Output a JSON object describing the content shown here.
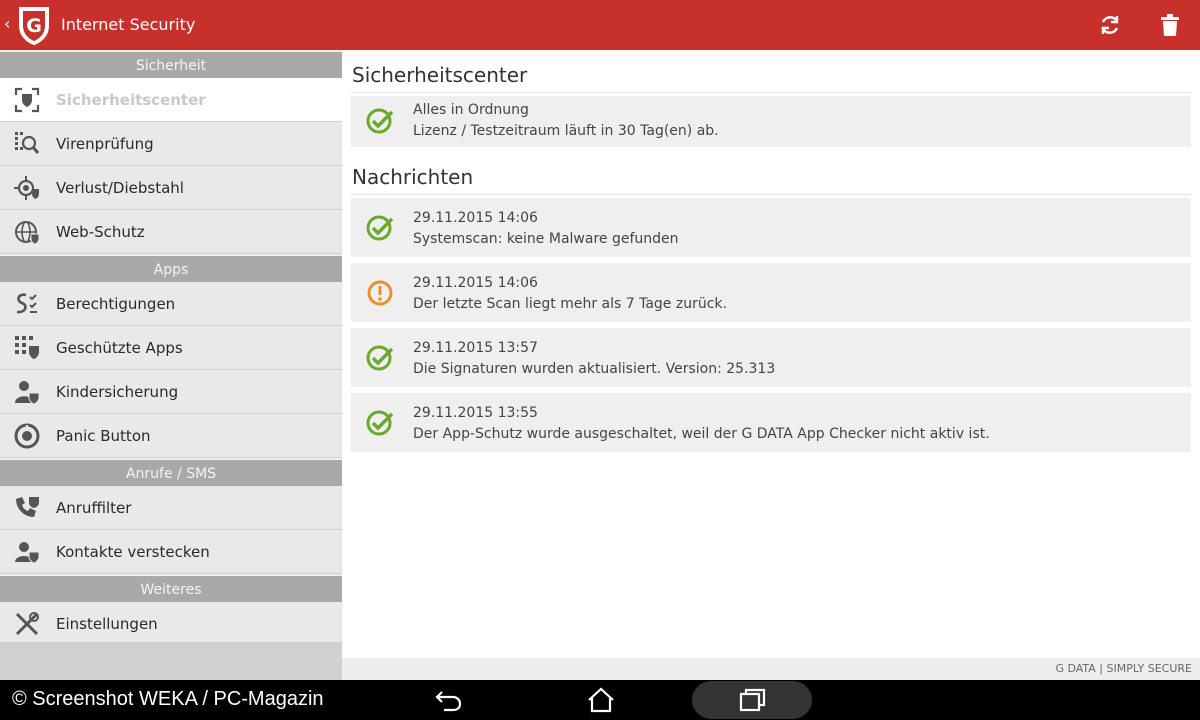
{
  "app": {
    "title": "Internet Security",
    "back_glyph": "‹",
    "logo_letter": "G",
    "actions": [
      "refresh-icon",
      "trash-icon"
    ]
  },
  "colors": {
    "accent": "#c8302c",
    "ok": "#6aa82e",
    "warn": "#e8912c"
  },
  "sidebar": {
    "sections": [
      {
        "title": "Sicherheit",
        "items": [
          {
            "label": "Sicherheitscenter",
            "icon": "shield-frame-icon",
            "active": true
          },
          {
            "label": "Virenprüfung",
            "icon": "virus-scan-icon"
          },
          {
            "label": "Verlust/Diebstahl",
            "icon": "locate-icon"
          },
          {
            "label": "Web-Schutz",
            "icon": "globe-shield-icon"
          }
        ]
      },
      {
        "title": "Apps",
        "items": [
          {
            "label": "Berechtigungen",
            "icon": "permissions-icon"
          },
          {
            "label": "Geschützte Apps",
            "icon": "protected-apps-icon"
          },
          {
            "label": "Kindersicherung",
            "icon": "parental-control-icon"
          },
          {
            "label": "Panic Button",
            "icon": "panic-button-icon"
          }
        ]
      },
      {
        "title": "Anrufe / SMS",
        "items": [
          {
            "label": "Anruffilter",
            "icon": "call-filter-icon"
          },
          {
            "label": "Kontakte verstecken",
            "icon": "hide-contacts-icon"
          }
        ]
      },
      {
        "title": "Weiteres",
        "items": [
          {
            "label": "Einstellungen",
            "icon": "settings-tools-icon"
          }
        ]
      }
    ]
  },
  "main": {
    "status_title": "Sicherheitscenter",
    "status": {
      "line1": "Alles in Ordnung",
      "line2": "Lizenz / Testzeitraum läuft in 30 Tag(en) ab.",
      "type": "ok"
    },
    "news_title": "Nachrichten",
    "messages": [
      {
        "date": "29.11.2015 14:06",
        "text": "Systemscan: keine Malware gefunden",
        "type": "ok"
      },
      {
        "date": "29.11.2015 14:06",
        "text": "Der letzte Scan liegt mehr als 7 Tage zurück.",
        "type": "warn"
      },
      {
        "date": "29.11.2015 13:57",
        "text": "Die Signaturen wurden aktualisiert. Version: 25.313",
        "type": "ok"
      },
      {
        "date": "29.11.2015 13:55",
        "text": "Der App-Schutz wurde ausgeschaltet, weil der G DATA App Checker nicht aktiv ist.",
        "type": "ok"
      }
    ],
    "footer": "G DATA | SIMPLY SECURE"
  },
  "navbar": {
    "credit": "© Screenshot WEKA / PC-Magazin",
    "buttons": [
      "back-nav-icon",
      "home-icon",
      "recents-icon"
    ]
  }
}
